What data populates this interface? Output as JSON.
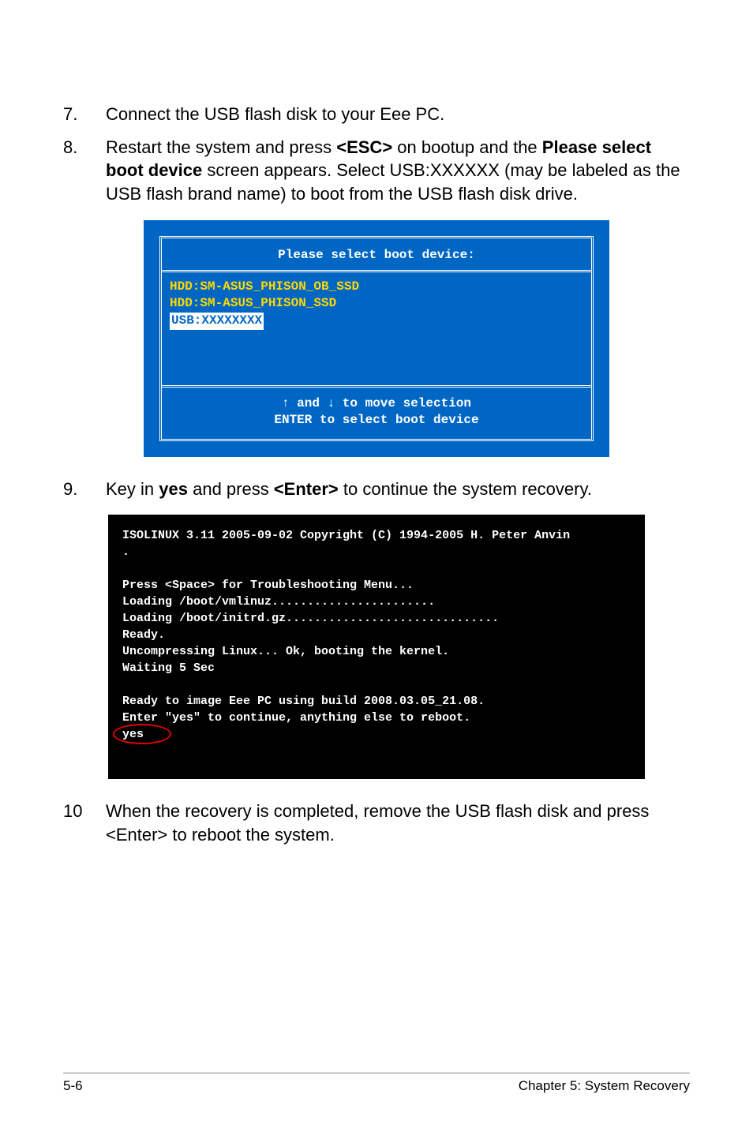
{
  "steps": {
    "s7": {
      "num": "7.",
      "text": "Connect the USB flash disk to your Eee PC."
    },
    "s8": {
      "num": "8.",
      "t1": "Restart the system and press ",
      "esc": "<ESC>",
      "t2": " on bootup and the ",
      "please": "Please select boot device",
      "t3": " screen appears. Select USB:XXXXXX (may be labeled as the USB flash brand name) to boot from the USB flash disk drive."
    },
    "s9": {
      "num": "9.",
      "t1": "Key in ",
      "yes": "yes",
      "t2": " and press ",
      "enter": "<Enter>",
      "t3": " to continue the system recovery."
    },
    "s10": {
      "num": "10",
      "text": "When the recovery is completed, remove the USB flash disk and press <Enter> to reboot the system."
    }
  },
  "boot": {
    "title": "Please select boot device:",
    "row1": "HDD:SM-ASUS_PHISON_OB_SSD",
    "row2": "HDD:SM-ASUS_PHISON_SSD",
    "row3": "USB:XXXXXXXX",
    "foot1": "↑ and ↓ to move selection",
    "foot2": "ENTER to select boot device"
  },
  "term": {
    "l1": "ISOLINUX 3.11 2005-09-02 Copyright (C) 1994-2005 H. Peter Anvin",
    "l2": ".",
    "l3": "",
    "l4": "Press <Space> for Troubleshooting Menu...",
    "l5": "Loading /boot/vmlinuz.......................",
    "l6": "Loading /boot/initrd.gz..............................",
    "l7": "Ready.",
    "l8": "Uncompressing Linux... Ok, booting the kernel.",
    "l9": "Waiting 5 Sec",
    "l10": "",
    "l11": "Ready to image Eee PC using build 2008.03.05_21.08.",
    "l12": "Enter \"yes\" to continue, anything else to reboot.",
    "l13": "yes"
  },
  "footer": {
    "left": "5-6",
    "right": "Chapter 5: System Recovery"
  }
}
